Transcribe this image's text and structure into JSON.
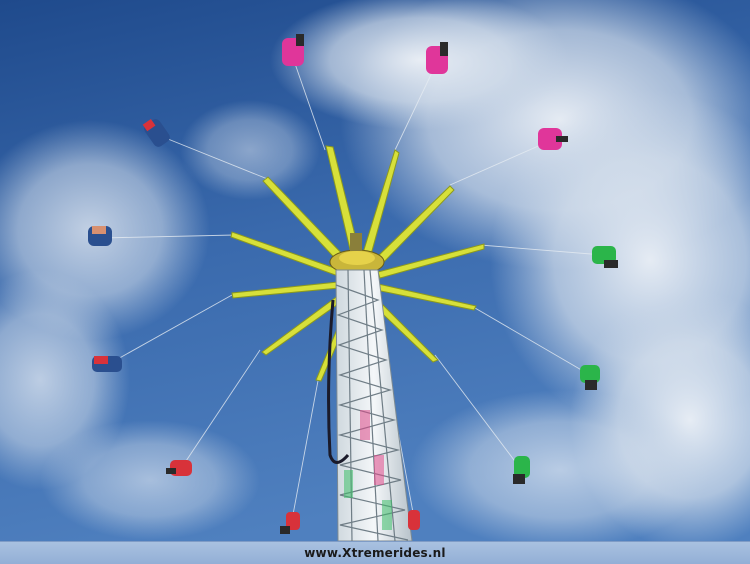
{
  "watermark": {
    "text": "www.Xtremerides.nl"
  },
  "colors": {
    "sky_top": "#1f4a8c",
    "sky_mid": "#3f6fb0",
    "cloud": "#dfe7f0",
    "arm_yellow": "#d9e23a",
    "tower_white": "#e8eef2",
    "seat_pink": "#e0369a",
    "seat_green": "#2bb54a",
    "seat_blue": "#2a4f8f",
    "seat_red": "#d8323a"
  }
}
